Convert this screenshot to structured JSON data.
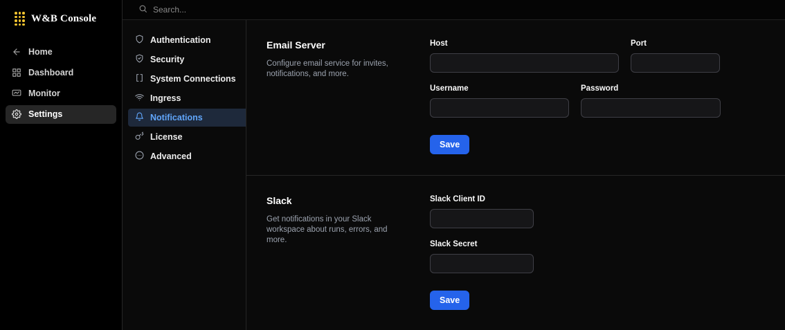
{
  "brand": {
    "title": "W&B Console",
    "logo_icon": "wandb-dots-logo",
    "logo_color": "#f4c430"
  },
  "search": {
    "placeholder": "Search...",
    "icon": "search-icon"
  },
  "sidebar": {
    "active": "Settings",
    "items": [
      {
        "label": "Home",
        "icon": "arrow-left-icon"
      },
      {
        "label": "Dashboard",
        "icon": "grid-icon"
      },
      {
        "label": "Monitor",
        "icon": "monitor-icon"
      },
      {
        "label": "Settings",
        "icon": "gear-icon"
      }
    ]
  },
  "settings_nav": {
    "active": "Notifications",
    "items": [
      {
        "label": "Authentication",
        "icon": "shield-icon"
      },
      {
        "label": "Security",
        "icon": "shield-check-icon"
      },
      {
        "label": "System Connections",
        "icon": "brackets-icon"
      },
      {
        "label": "Ingress",
        "icon": "wifi-icon"
      },
      {
        "label": "Notifications",
        "icon": "bell-icon"
      },
      {
        "label": "License",
        "icon": "key-icon"
      },
      {
        "label": "Advanced",
        "icon": "circle-ellipsis-icon"
      }
    ]
  },
  "email_section": {
    "title": "Email Server",
    "description": "Configure email service for invites, notifications, and more.",
    "fields": {
      "host": {
        "label": "Host",
        "value": ""
      },
      "port": {
        "label": "Port",
        "value": ""
      },
      "username": {
        "label": "Username",
        "value": ""
      },
      "password": {
        "label": "Password",
        "value": ""
      }
    },
    "save_label": "Save"
  },
  "slack_section": {
    "title": "Slack",
    "description": "Get notifications in your Slack workspace about runs, errors, and more.",
    "fields": {
      "client_id": {
        "label": "Slack Client ID",
        "value": ""
      },
      "secret": {
        "label": "Slack Secret",
        "value": ""
      }
    },
    "save_label": "Save"
  },
  "colors": {
    "accent_blue": "#2563eb",
    "brand_gold": "#f4c430",
    "active_nav_text": "#60a5fa",
    "active_nav_bg": "#1e293b"
  }
}
